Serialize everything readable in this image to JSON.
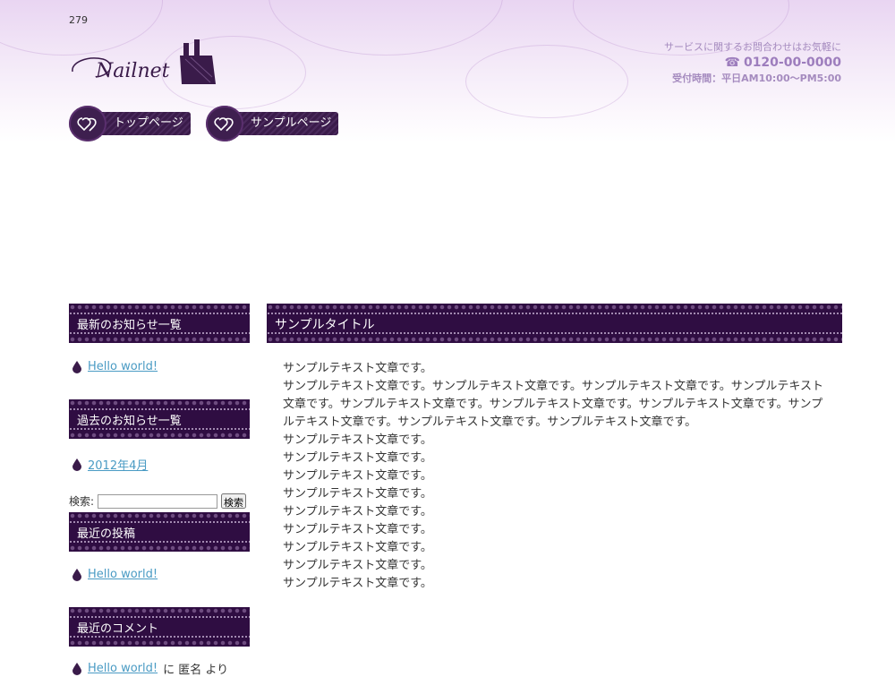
{
  "page": {
    "id_number": "279"
  },
  "brand": {
    "logo_text": "Nailnet",
    "accent": "#2f0d42"
  },
  "contact": {
    "line1": "サービスに関するお問合わせはお気軽に",
    "phone": "0120-00-0000",
    "hours": "受付時間：平日AM10:00〜PM5:00"
  },
  "nav": [
    {
      "label": "トップページ"
    },
    {
      "label": "サンプルページ"
    }
  ],
  "sidebar": {
    "recent_news": {
      "title": "最新のお知らせ一覧",
      "links": [
        "Hello world!"
      ]
    },
    "past_news": {
      "title": "過去のお知らせ一覧",
      "links": [
        "2012年4月"
      ]
    },
    "search": {
      "label": "検索:",
      "value": "",
      "button": "検索"
    },
    "recent_posts": {
      "title": "最近の投稿",
      "links": [
        "Hello world!"
      ]
    },
    "recent_comments": {
      "title": "最近のコメント",
      "link": "Hello world!",
      "suffix": "に 匿名 より"
    }
  },
  "main": {
    "title": "サンプルタイトル",
    "paragraphs": [
      "サンプルテキスト文章です。",
      "サンプルテキスト文章です。サンプルテキスト文章です。サンプルテキスト文章です。サンプルテキスト文章です。サンプルテキスト文章です。サンプルテキスト文章です。サンプルテキスト文章です。サンプルテキスト文章です。サンプルテキスト文章です。サンプルテキスト文章です。",
      "サンプルテキスト文章です。",
      "サンプルテキスト文章です。",
      "サンプルテキスト文章です。",
      "サンプルテキスト文章です。",
      "サンプルテキスト文章です。",
      "サンプルテキスト文章です。",
      "サンプルテキスト文章です。",
      "サンプルテキスト文章です。",
      "サンプルテキスト文章です。"
    ]
  }
}
